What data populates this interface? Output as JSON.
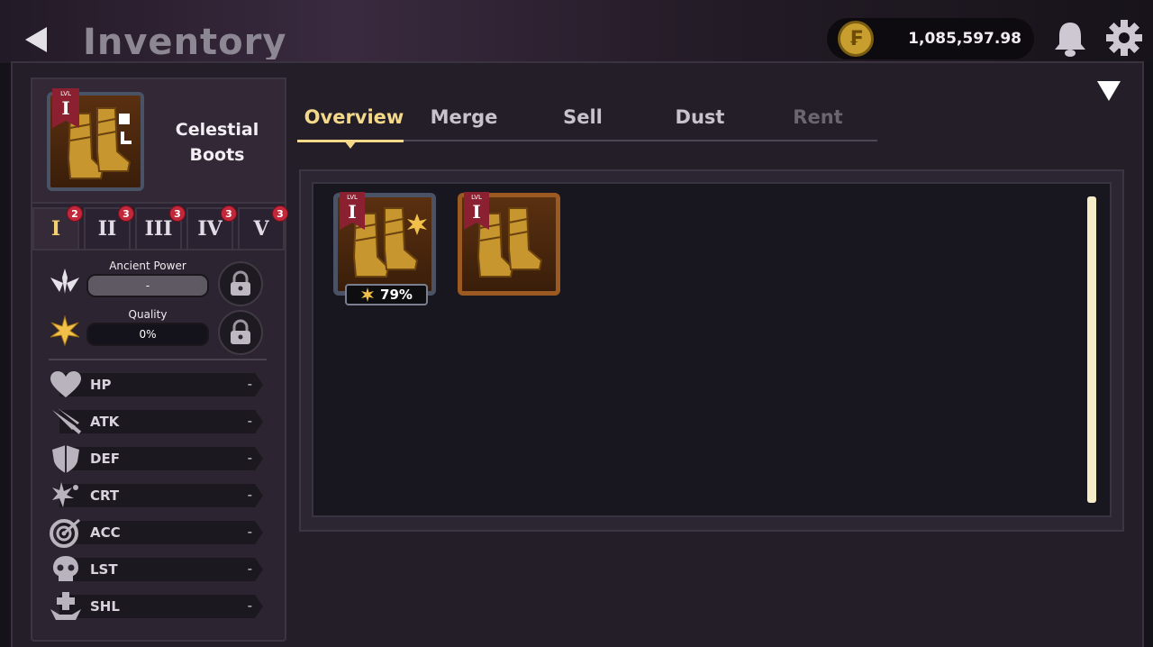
{
  "header": {
    "title": "Inventory",
    "currency_amount": "1,085,597.98",
    "coin_symbol": "₣"
  },
  "item": {
    "name_line1": "Celestial",
    "name_line2": "Boots",
    "level_prefix": "LVL",
    "level": "I"
  },
  "tiers": [
    {
      "label": "I",
      "badge": "2",
      "active": true
    },
    {
      "label": "II",
      "badge": "3"
    },
    {
      "label": "III",
      "badge": "3"
    },
    {
      "label": "IV",
      "badge": "3"
    },
    {
      "label": "V",
      "badge": "3"
    }
  ],
  "ancient_power": {
    "label": "Ancient Power",
    "value": "-"
  },
  "quality": {
    "label": "Quality",
    "value": "0%"
  },
  "stats": [
    {
      "label": "HP",
      "value": "-",
      "icon": "heart-icon"
    },
    {
      "label": "ATK",
      "value": "-",
      "icon": "sword-icon"
    },
    {
      "label": "DEF",
      "value": "-",
      "icon": "shield-icon"
    },
    {
      "label": "CRT",
      "value": "-",
      "icon": "critical-icon"
    },
    {
      "label": "ACC",
      "value": "-",
      "icon": "target-icon"
    },
    {
      "label": "LST",
      "value": "-",
      "icon": "skull-icon"
    },
    {
      "label": "SHL",
      "value": "-",
      "icon": "heal-icon"
    }
  ],
  "tabs": [
    {
      "label": "Overview",
      "state": "active"
    },
    {
      "label": "Merge",
      "state": "normal"
    },
    {
      "label": "Sell",
      "state": "normal"
    },
    {
      "label": "Dust",
      "state": "normal"
    },
    {
      "label": "Rent",
      "state": "disabled"
    }
  ],
  "inventory": [
    {
      "level_prefix": "LVL",
      "level": "I",
      "quality": "79%",
      "frame": "silver"
    },
    {
      "level_prefix": "LVL",
      "level": "I",
      "frame": "bronze"
    }
  ],
  "colors": {
    "accent_gold": "#f4d98a",
    "badge_red": "#c3283a",
    "scrollbar": "#f5ecc8"
  }
}
